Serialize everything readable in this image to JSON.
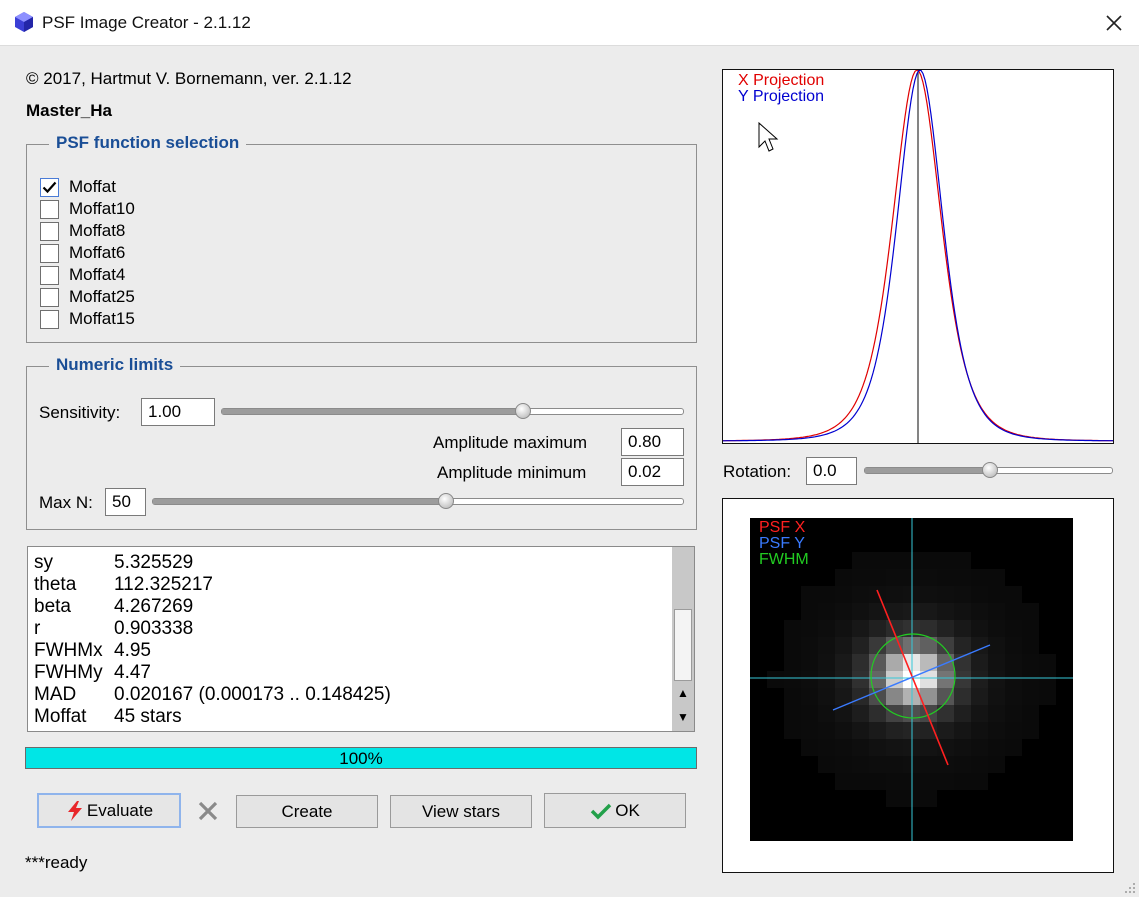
{
  "window": {
    "title": "PSF Image Creator - 2.1.12"
  },
  "header": {
    "copyright": "© 2017, Hartmut V. Bornemann, ver. 2.1.12",
    "image_name": "Master_Ha"
  },
  "psf_selection": {
    "title": "PSF function selection",
    "options": [
      {
        "label": "Moffat",
        "checked": true
      },
      {
        "label": "Moffat10",
        "checked": false
      },
      {
        "label": "Moffat8",
        "checked": false
      },
      {
        "label": "Moffat6",
        "checked": false
      },
      {
        "label": "Moffat4",
        "checked": false
      },
      {
        "label": "Moffat25",
        "checked": false
      },
      {
        "label": "Moffat15",
        "checked": false
      }
    ]
  },
  "numeric_limits": {
    "title": "Numeric limits",
    "sensitivity_label": "Sensitivity:",
    "sensitivity_value": "1.00",
    "sensitivity_slider": 0.65,
    "amplitude_max_label": "Amplitude maximum",
    "amplitude_max_value": "0.80",
    "amplitude_min_label": "Amplitude minimum",
    "amplitude_min_value": "0.02",
    "maxn_label": "Max N:",
    "maxn_value": "50",
    "maxn_slider": 0.55
  },
  "log": {
    "lines": [
      {
        "key": "sy",
        "value": "5.325529"
      },
      {
        "key": "theta",
        "value": "112.325217"
      },
      {
        "key": "beta",
        "value": "4.267269"
      },
      {
        "key": "r",
        "value": "0.903338"
      },
      {
        "key": "FWHMx",
        "value": "4.95"
      },
      {
        "key": "FWHMy",
        "value": "4.47"
      },
      {
        "key": "MAD",
        "value": "0.020167 (0.000173 .. 0.148425)"
      },
      {
        "key": "Moffat",
        "value": "45 stars"
      }
    ]
  },
  "progress": {
    "text": "100%",
    "value": 1.0
  },
  "buttons": {
    "evaluate": "Evaluate",
    "create": "Create",
    "view_stars": "View stars",
    "ok": "OK"
  },
  "status": "***ready",
  "projection_plot": {
    "legend": [
      "X Projection",
      "Y Projection"
    ],
    "colors": {
      "x": "#e00000",
      "y": "#0000d0"
    }
  },
  "rotation": {
    "label": "Rotation:",
    "value": "0.0",
    "slider": 0.5
  },
  "psf_image": {
    "legend": [
      "PSF X",
      "PSF Y",
      "FWHM"
    ],
    "colors": {
      "psf_x": "#ff2020",
      "psf_y": "#3a7bff",
      "fwhm": "#22cc22",
      "crosshair": "#36c8d8"
    }
  }
}
